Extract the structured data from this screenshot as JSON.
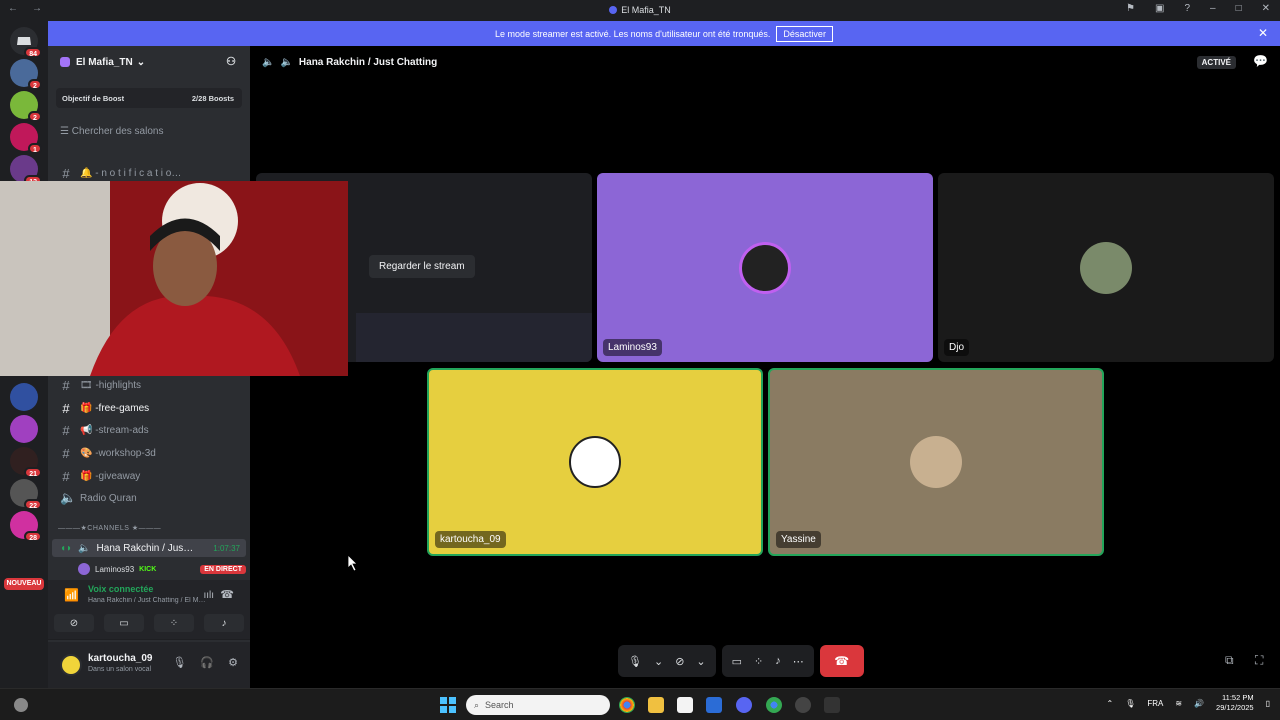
{
  "window": {
    "title": "El Mafia_TN"
  },
  "banner": {
    "text": "Le mode streamer est activé. Les noms d'utilisateur ont été tronqués.",
    "button": "Désactiver"
  },
  "rail": {
    "badges": [
      "84",
      "2",
      "2",
      "1",
      "13",
      "21",
      "22",
      "28"
    ],
    "new_label": "NOUVEAU"
  },
  "sidebar": {
    "server_name": "El Mafia_TN",
    "boost_label": "Objectif de Boost",
    "boost_count": "2/28 Boosts",
    "search_placeholder": "Chercher des salons",
    "channels": [
      {
        "name": "🔔 - n o t i f i c a t i o…"
      },
      {
        "name": "🎞 -highlights"
      },
      {
        "name": "🎁 -free-games"
      },
      {
        "name": "📢 -stream-ads"
      },
      {
        "name": "🎨 -workshop-3d"
      },
      {
        "name": "🎁 -giveaway"
      },
      {
        "name": "Radio Quran"
      }
    ],
    "category": "———★CHANNELS ★———",
    "voice_channel": {
      "name": "Hana Rakchin / Jus…",
      "time": "1:07:37"
    },
    "member": {
      "name": "Laminos93",
      "badge": "KICK",
      "live": "EN DIRECT"
    }
  },
  "voice_panel": {
    "status": "Voix connectée",
    "subtitle": "Hana Rakchin / Just Chatting / El M…"
  },
  "user": {
    "name": "kartoucha_09",
    "status": "Dans un salon vocal"
  },
  "main": {
    "channel_title": "Hana Rakchin / Just Chatting",
    "active_badge": "ACTIVÉ",
    "watch_stream": "Regarder le stream",
    "participants": [
      {
        "name": "Laminos93",
        "color": "#8c66d6"
      },
      {
        "name": "Djo",
        "color": "#1a1a1a"
      },
      {
        "name": "kartoucha_09",
        "color": "#e6cf3f"
      },
      {
        "name": "Yassine",
        "color": "#8a7b62"
      }
    ]
  },
  "taskbar": {
    "search": "Search",
    "lang": "FRA",
    "time": "11:52 PM",
    "date": "29/12/2025"
  },
  "icons": [
    "discord-icon",
    "mic-icon",
    "camera-off-icon",
    "screen-share-icon",
    "activities-icon",
    "soundboard-icon",
    "more-icon",
    "hang-up-icon",
    "headphones-icon",
    "settings-icon",
    "chat-icon",
    "popout-icon",
    "fullscreen-icon"
  ]
}
